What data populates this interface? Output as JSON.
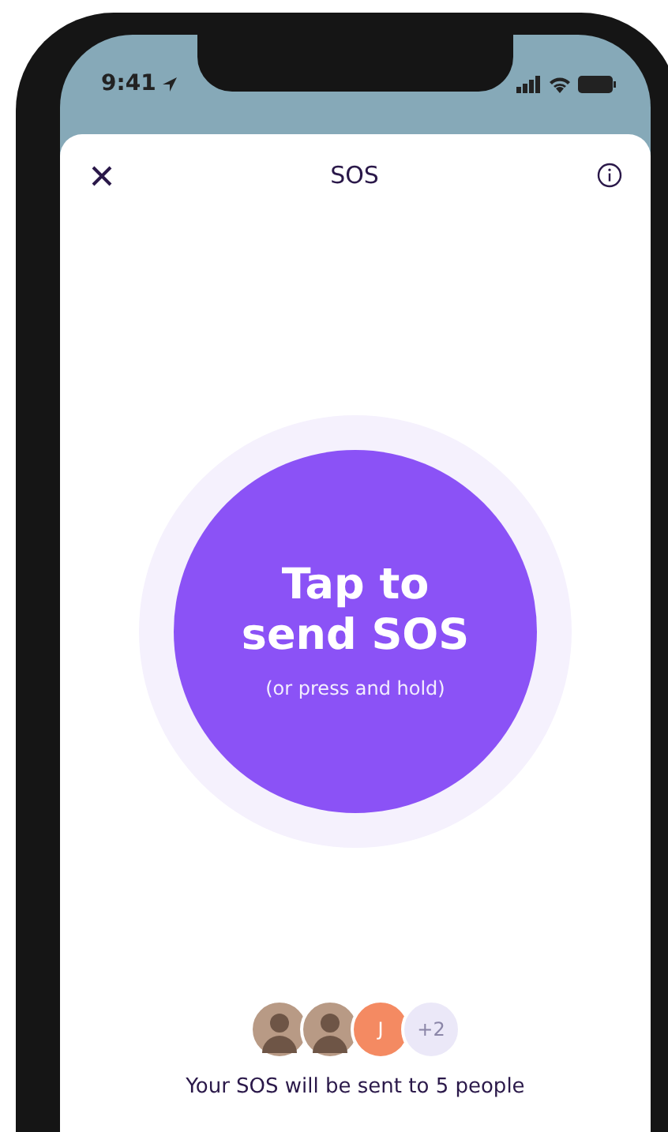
{
  "status_bar": {
    "time": "9:41"
  },
  "header": {
    "title": "SOS"
  },
  "sos_button": {
    "title": "Tap to send SOS",
    "subtitle": "(or press and hold)"
  },
  "recipients": [
    {
      "kind": "photo"
    },
    {
      "kind": "photo"
    },
    {
      "kind": "initial",
      "label": "J"
    },
    {
      "kind": "more",
      "label": "+2"
    }
  ],
  "footer": {
    "text": "Your SOS will be sent to 5 people"
  }
}
